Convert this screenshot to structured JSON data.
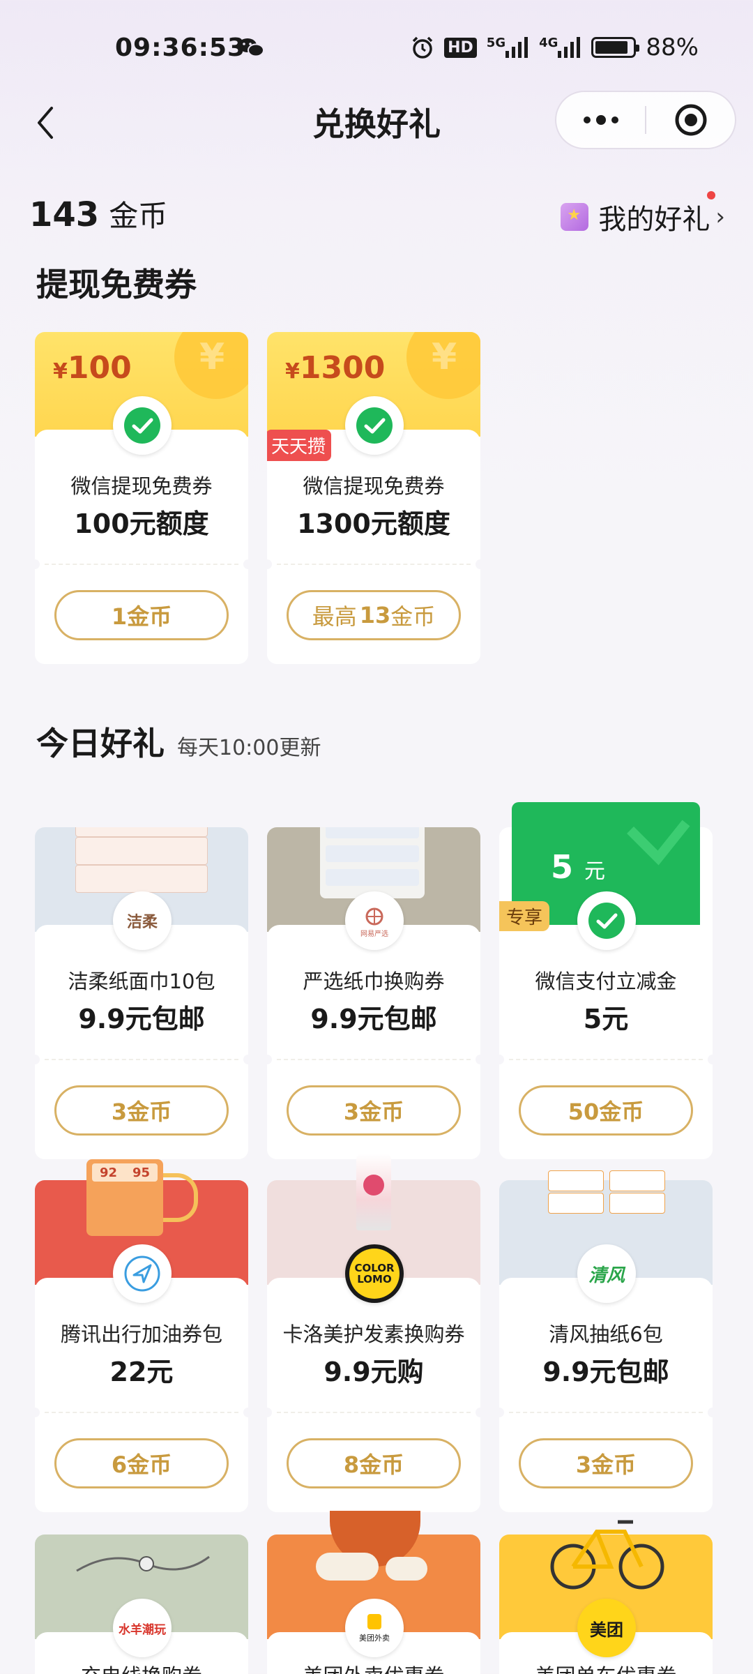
{
  "status_bar": {
    "time": "09:36:53",
    "network_5g": "5G",
    "network_4g": "4G",
    "hd": "HD",
    "battery_pct": "88%",
    "battery_level": 0.88
  },
  "nav": {
    "title": "兑换好礼",
    "more_icon": "more-dots-icon",
    "close_icon": "target-close-icon"
  },
  "header": {
    "coins_value": "143",
    "coins_unit": "金币",
    "my_gifts_label": "我的好礼"
  },
  "sections": {
    "withdraw": {
      "title": "提现免费券"
    },
    "today": {
      "title": "今日好礼",
      "subtitle": "每天10:00更新"
    }
  },
  "withdraw_cards": [
    {
      "amount_symbol": "¥",
      "amount": "100",
      "name": "微信提现免费券",
      "value": "100元额度",
      "button": "1金币",
      "icon": "wechat-pay-icon"
    },
    {
      "amount_symbol": "¥",
      "amount": "1300",
      "name": "微信提现免费券",
      "value": "1300元额度",
      "badge": "天天攒",
      "button_prefix": "最高",
      "button_num": "13",
      "button_unit": "金币",
      "icon": "wechat-pay-icon"
    }
  ],
  "gift_cards": [
    {
      "name": "洁柔纸面巾10包",
      "value": "9.9元包邮",
      "button": "3金币",
      "logo_text": "洁柔",
      "top_color": "#dfe6ee"
    },
    {
      "name": "严选纸巾换购券",
      "value": "9.9元包邮",
      "button": "3金币",
      "logo_text": "网易严选",
      "top_color": "#bcb6a6"
    },
    {
      "name": "微信支付立减金",
      "value": "5元",
      "button": "50金币",
      "ticket_amount": "5",
      "ticket_unit": "元",
      "badge": "专享",
      "top_color": "#1fb85a"
    },
    {
      "name": "腾讯出行加油券包",
      "value": "22元",
      "button": "6金币",
      "pump_digits_left": "92",
      "pump_digits_right": "95",
      "top_color": "#e85a4c"
    },
    {
      "name": "卡洛美护发素换购券",
      "value": "9.9元购",
      "button": "8金币",
      "logo_text_1": "COLOR",
      "logo_text_2": "LOMO",
      "top_color": "#f0dedd"
    },
    {
      "name": "清风抽纸6包",
      "value": "9.9元包邮",
      "button": "3金币",
      "logo_text": "清风",
      "top_color": "#dfe6ee"
    },
    {
      "name": "充电线换购券",
      "logo_text": "水羊潮玩",
      "top_color": "#c7d1bd"
    },
    {
      "name": "美团外卖优惠券",
      "logo_text": "美团外卖",
      "top_color": "#f28a45"
    },
    {
      "name": "美团单车优惠券",
      "logo_text": "美团",
      "top_color": "#ffc93a"
    }
  ],
  "colors": {
    "accent_gold": "#d8b164",
    "wechat_green": "#1fb85a",
    "badge_red": "#ee4f4f"
  }
}
